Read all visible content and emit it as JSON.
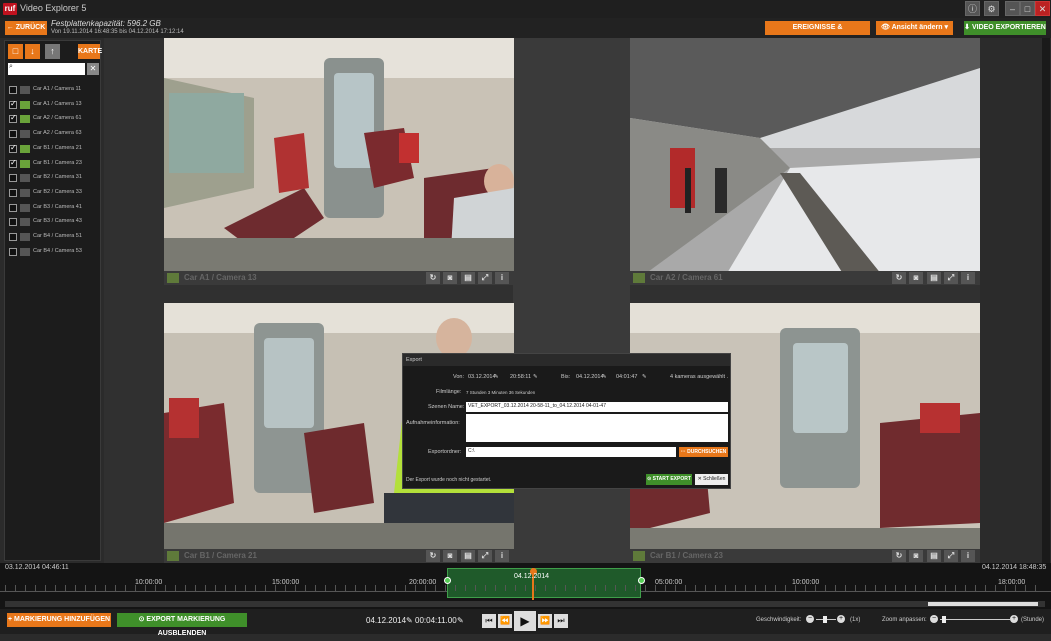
{
  "app": {
    "logo": "ruf",
    "title": "Video Explorer 5"
  },
  "window": {
    "info_icon": "i",
    "settings_icon": "gear",
    "min": "–",
    "max": "□",
    "close": "✕"
  },
  "toolbar": {
    "back_label": "← ZURÜCK",
    "capacity": "Festplattenkapazität: 596.2 GB",
    "range": "Von 19.11.2014 16:48:35 bis 04.12.2014 17:12:14",
    "events_label": "EREIGNISSE & MARKIERUNGEN",
    "view_label": "Ansicht ändern",
    "export_label": "VIDEO EXPORTIEREN"
  },
  "sidebar": {
    "karte_label": "KARTE",
    "search_placeholder": "",
    "cameras": [
      {
        "label": "Car A1 / Camera 11",
        "checked": false
      },
      {
        "label": "Car A1 / Camera 13",
        "checked": true
      },
      {
        "label": "Car A2 / Camera 61",
        "checked": true
      },
      {
        "label": "Car A2 / Camera 63",
        "checked": false
      },
      {
        "label": "Car B1 / Camera 21",
        "checked": true
      },
      {
        "label": "Car B1 / Camera 23",
        "checked": true
      },
      {
        "label": "Car B2 / Camera 31",
        "checked": false
      },
      {
        "label": "Car B2 / Camera 33",
        "checked": false
      },
      {
        "label": "Car B3 / Camera 41",
        "checked": false
      },
      {
        "label": "Car B3 / Camera 43",
        "checked": false
      },
      {
        "label": "Car B4 / Camera 51",
        "checked": false
      },
      {
        "label": "Car B4 / Camera 53",
        "checked": false
      }
    ]
  },
  "tiles": [
    {
      "label": "Car A1 / Camera 13"
    },
    {
      "label": "Car A2 / Camera 61"
    },
    {
      "label": "Car B1 / Camera 21"
    },
    {
      "label": "Car B1 / Camera 23"
    }
  ],
  "dialog": {
    "title": "Export",
    "von_label": "Von:",
    "von_date": "03.12.2014",
    "von_time": "20:58:11",
    "bis_label": "Bis:",
    "bis_date": "04.12.2014",
    "bis_time": "04:01:47",
    "cameras_selected": "4 kameras ausgewählt .",
    "film_label": "Filmlänge:",
    "film_value": "7 Stunden 3 Minuten 36 Sekunden",
    "scene_label": "Szenen Name:",
    "scene_value": "VET_EXPORT_03.12.2014 20-58-11_to_04.12.2014 04-01-47",
    "info_label": "Aufnahmeinformation:",
    "folder_label": "Exportordner:",
    "folder_value": "C:\\",
    "browse_label": "··· DURCHSUCHEN",
    "status": "Der Export wurde noch nicht gestartet.",
    "start_label": "⊙ START EXPORT",
    "close_label": "✕ Schließen"
  },
  "timeline": {
    "start": "03.12.2014 04:46:11",
    "end": "04.12.2014 18:48:35",
    "ticks": [
      "10:00:00",
      "15:00:00",
      "20:00:00",
      "04.12.2014",
      "05:00:00",
      "10:00:00",
      "18:00:00"
    ]
  },
  "bottom": {
    "add_marker": "+ MARKIERUNG HINZUFÜGEN",
    "hide_export": "⊙ EXPORT MARKIERUNG AUSBLENDEN",
    "date": "04.12.2014",
    "time": "00:04:11.00",
    "speed_label": "Geschwindigkeit:",
    "speed_value": "(1x)",
    "zoom_label": "Zoom anpassen:",
    "zoom_unit": "(Stunde)"
  },
  "colors": {
    "accent": "#e8771a",
    "green": "#3f8f2a"
  }
}
